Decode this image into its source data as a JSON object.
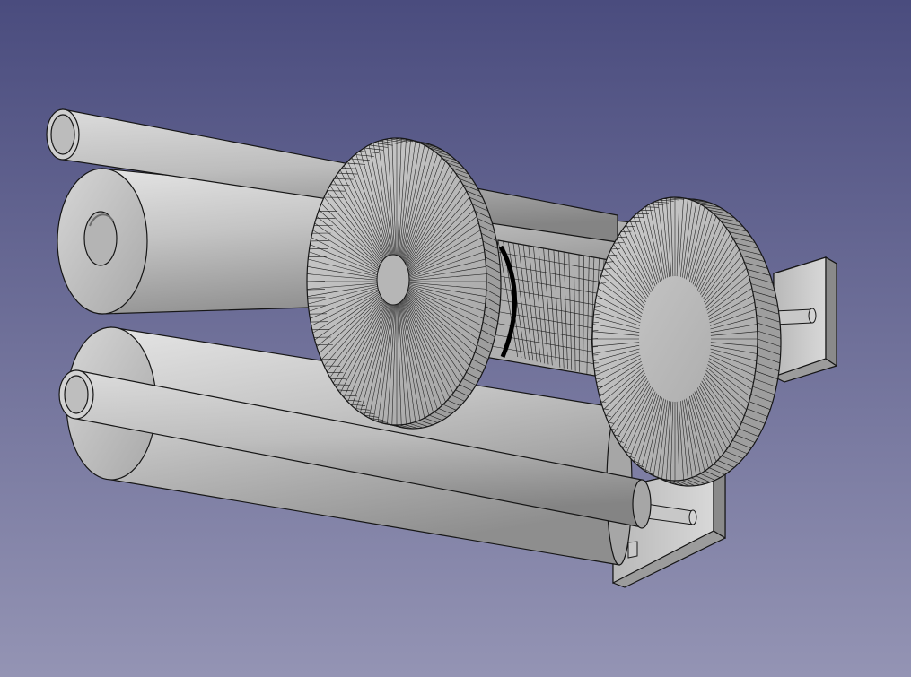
{
  "viewport": {
    "background_top": "#4a4c7e",
    "background_bottom": "#9494b4",
    "shape_color": "#c6c6c6",
    "edge_color": "#161616"
  },
  "scene": {
    "objects": [
      {
        "name": "upper-rod"
      },
      {
        "name": "large-hollow-cylinder"
      },
      {
        "name": "lower-cylinder"
      },
      {
        "name": "lower-rod"
      },
      {
        "name": "front-flange-disc"
      },
      {
        "name": "rear-flange-disc"
      },
      {
        "name": "mesh-hub-cylinder"
      },
      {
        "name": "mounting-plate-upper"
      },
      {
        "name": "mounting-plate-lower"
      },
      {
        "name": "shaft-pin-upper"
      },
      {
        "name": "shaft-pin-lower"
      }
    ]
  }
}
